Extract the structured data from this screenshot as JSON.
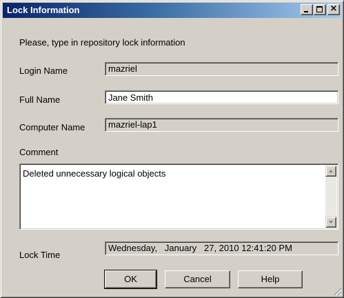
{
  "window": {
    "title": "Lock Information"
  },
  "prompt": "Please, type in repository lock information",
  "fields": {
    "login_name": {
      "label": "Login Name",
      "value": "mazriel"
    },
    "full_name": {
      "label": "Full Name",
      "value": "Jane Smith"
    },
    "computer_name": {
      "label": "Computer Name",
      "value": "mazriel-lap1"
    },
    "comment": {
      "label": "Comment",
      "value": "Deleted unnecessary logical objects"
    },
    "lock_time": {
      "label": "Lock Time",
      "value": "Wednesday,   January   27, 2010 12:41:20 PM"
    }
  },
  "buttons": {
    "ok": "OK",
    "cancel": "Cancel",
    "help": "Help"
  },
  "titlebar_buttons": {
    "minimize": "minimize-icon",
    "maximize": "maximize-icon",
    "close": "close-icon"
  },
  "colors": {
    "title_start": "#0a246a",
    "title_end": "#a6caf0",
    "face": "#d4d0c8"
  }
}
